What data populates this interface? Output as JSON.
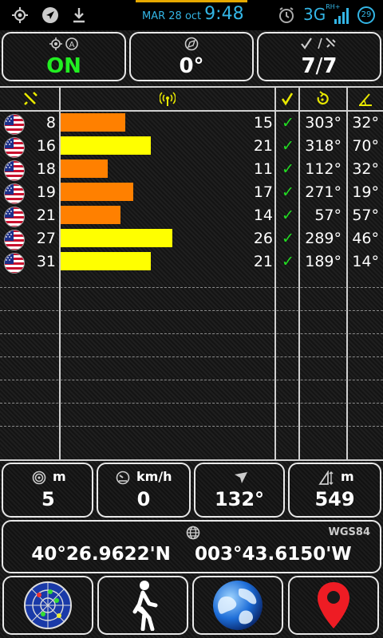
{
  "status_bar": {
    "date": "MAR 28 oct",
    "time": "9:48",
    "network": "3G",
    "network_sup": "RH+",
    "battery": "29",
    "icons": [
      "gps-icon",
      "navigation-icon",
      "download-icon",
      "alarm-icon",
      "signal-icon",
      "battery-icon"
    ]
  },
  "top_panels": {
    "fix": {
      "value": "ON",
      "icons": [
        "gps-fix-icon",
        "gps-auto-icon"
      ],
      "color": "#22ee22"
    },
    "bearing": {
      "value": "0°",
      "icon": "compass-icon"
    },
    "satellites": {
      "value_used": "7",
      "separator": "/",
      "value_total": "7",
      "icons": [
        "check-icon",
        "satellite-icon"
      ]
    }
  },
  "table": {
    "header_icons": [
      "satellite-icon",
      "signal-strength-icon",
      "used-check-icon",
      "azimuth-icon",
      "elevation-icon"
    ],
    "header_color": "#e8e800",
    "rows": [
      {
        "prn": "8",
        "snr": "15",
        "bar_level": 15,
        "bar_color": "#ff8000",
        "used": "✓",
        "az": "303°",
        "el": "32°"
      },
      {
        "prn": "16",
        "snr": "21",
        "bar_level": 21,
        "bar_color": "#ffff00",
        "used": "✓",
        "az": "318°",
        "el": "70°"
      },
      {
        "prn": "18",
        "snr": "11",
        "bar_level": 11,
        "bar_color": "#ff8000",
        "used": "✓",
        "az": "112°",
        "el": "32°"
      },
      {
        "prn": "19",
        "snr": "17",
        "bar_level": 17,
        "bar_color": "#ff8000",
        "used": "✓",
        "az": "271°",
        "el": "19°"
      },
      {
        "prn": "21",
        "snr": "14",
        "bar_level": 14,
        "bar_color": "#ff8000",
        "used": "✓",
        "az": "57°",
        "el": "57°"
      },
      {
        "prn": "27",
        "snr": "26",
        "bar_level": 26,
        "bar_color": "#ffff00",
        "used": "✓",
        "az": "289°",
        "el": "46°"
      },
      {
        "prn": "31",
        "snr": "21",
        "bar_level": 21,
        "bar_color": "#ffff00",
        "used": "✓",
        "az": "189°",
        "el": "14°"
      }
    ]
  },
  "info_panels": {
    "accuracy": {
      "unit": "m",
      "value": "5",
      "icon": "accuracy-icon"
    },
    "speed": {
      "unit": "km/h",
      "value": "0",
      "icon": "speedometer-icon"
    },
    "heading": {
      "value": "132°",
      "icon": "heading-icon"
    },
    "altitude": {
      "unit": "m",
      "value": "549",
      "icon": "altitude-icon"
    }
  },
  "coordinates": {
    "datum": "WGS84",
    "latitude": "40°26.9622'N",
    "longitude": "003°43.6150'W",
    "icon": "globe-icon"
  },
  "bottom_nav": [
    "radar-button",
    "walk-button",
    "earth-button",
    "map-pin-button"
  ]
}
